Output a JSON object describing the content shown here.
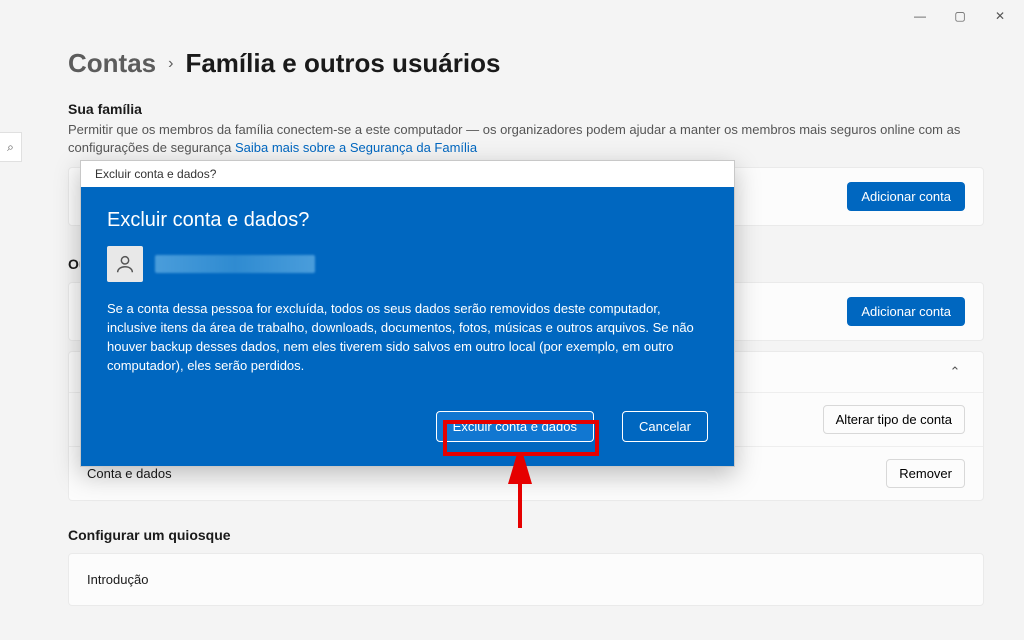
{
  "window": {
    "min": "—",
    "max": "▢",
    "close": "✕"
  },
  "search_icon": "⌕",
  "breadcrumb": {
    "parent": "Contas",
    "arrow": "›",
    "current": "Família e outros usuários"
  },
  "family": {
    "heading": "Sua família",
    "desc": "Permitir que os membros da família conectem-se a este computador — os organizadores podem ajudar a manter os membros mais seguros online com as configurações de segurança",
    "link": "Saiba mais sobre a Segurança da Família",
    "add_btn": "Adicionar conta",
    "card_left": " "
  },
  "others": {
    "heading_short": "Ou",
    "add_btn": "Adicionar conta",
    "card1_left": " ",
    "expand_chev": "⌃",
    "change_type": "Alterar tipo de conta",
    "account_data_label": "Conta e dados",
    "remove_btn": "Remover"
  },
  "kiosk": {
    "heading": "Configurar um quiosque",
    "intro": "Introdução"
  },
  "dialog": {
    "titlebar": "Excluir conta e dados?",
    "heading": "Excluir conta e dados?",
    "body": "Se a conta dessa pessoa for excluída, todos os seus dados serão removidos deste computador, inclusive itens da área de trabalho, downloads, documentos, fotos, músicas e outros arquivos. Se não houver backup desses dados, nem eles tiverem sido salvos em outro local (por exemplo, em outro computador), eles serão perdidos.",
    "confirm": "Excluir conta e dados",
    "cancel": "Cancelar"
  }
}
